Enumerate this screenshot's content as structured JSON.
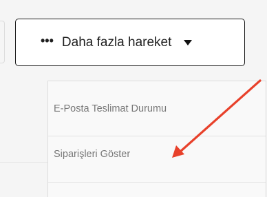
{
  "more_actions": {
    "dots": "•••",
    "label": "Daha fazla hareket"
  },
  "dropdown": {
    "items": [
      {
        "label": "E-Posta Teslimat Durumu"
      },
      {
        "label": "Siparişleri Göster"
      }
    ]
  },
  "colors": {
    "annotation_arrow": "#e8412b"
  }
}
